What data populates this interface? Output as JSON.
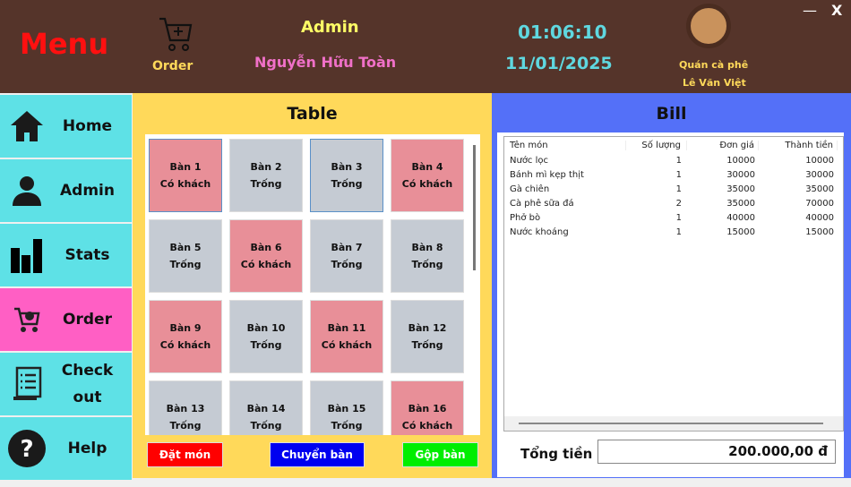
{
  "header": {
    "menu_title": "Menu",
    "order_label": "Order",
    "role": "Admin",
    "user_name": "Nguyễn Hữu Toàn",
    "time": "01:06:10",
    "date": "11/01/2025",
    "shop_line1": "Quán cà phê",
    "shop_line2": "Lê Văn Việt",
    "minimize": "—",
    "close": "X"
  },
  "sidebar": {
    "items": [
      {
        "label": "Home",
        "icon": "home-icon"
      },
      {
        "label": "Admin",
        "icon": "user-icon"
      },
      {
        "label": "Stats",
        "icon": "bar-chart-icon"
      },
      {
        "label": "Order",
        "icon": "cart-check-icon",
        "active": true
      },
      {
        "label": "Check\nout",
        "icon": "receipt-icon"
      },
      {
        "label": "Help",
        "icon": "help-icon"
      }
    ]
  },
  "tables": {
    "title": "Table",
    "items": [
      {
        "name": "Bàn 1",
        "status": "Có khách"
      },
      {
        "name": "Bàn 2",
        "status": "Trống"
      },
      {
        "name": "Bàn 3",
        "status": "Trống"
      },
      {
        "name": "Bàn 4",
        "status": "Có khách"
      },
      {
        "name": "Bàn 5",
        "status": "Trống"
      },
      {
        "name": "Bàn 6",
        "status": "Có khách"
      },
      {
        "name": "Bàn 7",
        "status": "Trống"
      },
      {
        "name": "Bàn 8",
        "status": "Trống"
      },
      {
        "name": "Bàn 9",
        "status": "Có khách"
      },
      {
        "name": "Bàn 10",
        "status": "Trống"
      },
      {
        "name": "Bàn 11",
        "status": "Có khách"
      },
      {
        "name": "Bàn 12",
        "status": "Trống"
      },
      {
        "name": "Bàn 13",
        "status": "Trống"
      },
      {
        "name": "Bàn 14",
        "status": "Trống"
      },
      {
        "name": "Bàn 15",
        "status": "Trống"
      },
      {
        "name": "Bàn 16",
        "status": "Có khách"
      }
    ],
    "buttons": {
      "order": "Đặt món",
      "move": "Chuyển bàn",
      "merge": "Gộp bàn"
    }
  },
  "bill": {
    "title": "Bill",
    "columns": [
      "Tên món",
      "Số lượng",
      "Đơn giá",
      "Thành tiền"
    ],
    "rows": [
      [
        "Nước lọc",
        "1",
        "10000",
        "10000"
      ],
      [
        "Bánh mì kẹp thịt",
        "1",
        "30000",
        "30000"
      ],
      [
        "Gà chiên",
        "1",
        "35000",
        "35000"
      ],
      [
        "Cà phê sữa đá",
        "2",
        "35000",
        "70000"
      ],
      [
        "Phở bò",
        "1",
        "40000",
        "40000"
      ],
      [
        "Nước khoáng",
        "1",
        "15000",
        "15000"
      ]
    ],
    "total_label": "Tổng tiền",
    "total_value": "200.000,00 đ"
  },
  "colors": {
    "header": "#55342a",
    "sidebar": "#5ee1e6",
    "active": "#ff5fc4",
    "table_panel": "#ffd95a",
    "bill_panel": "#5470f8",
    "busy": "#e88f98",
    "free": "#c5cbd3"
  }
}
